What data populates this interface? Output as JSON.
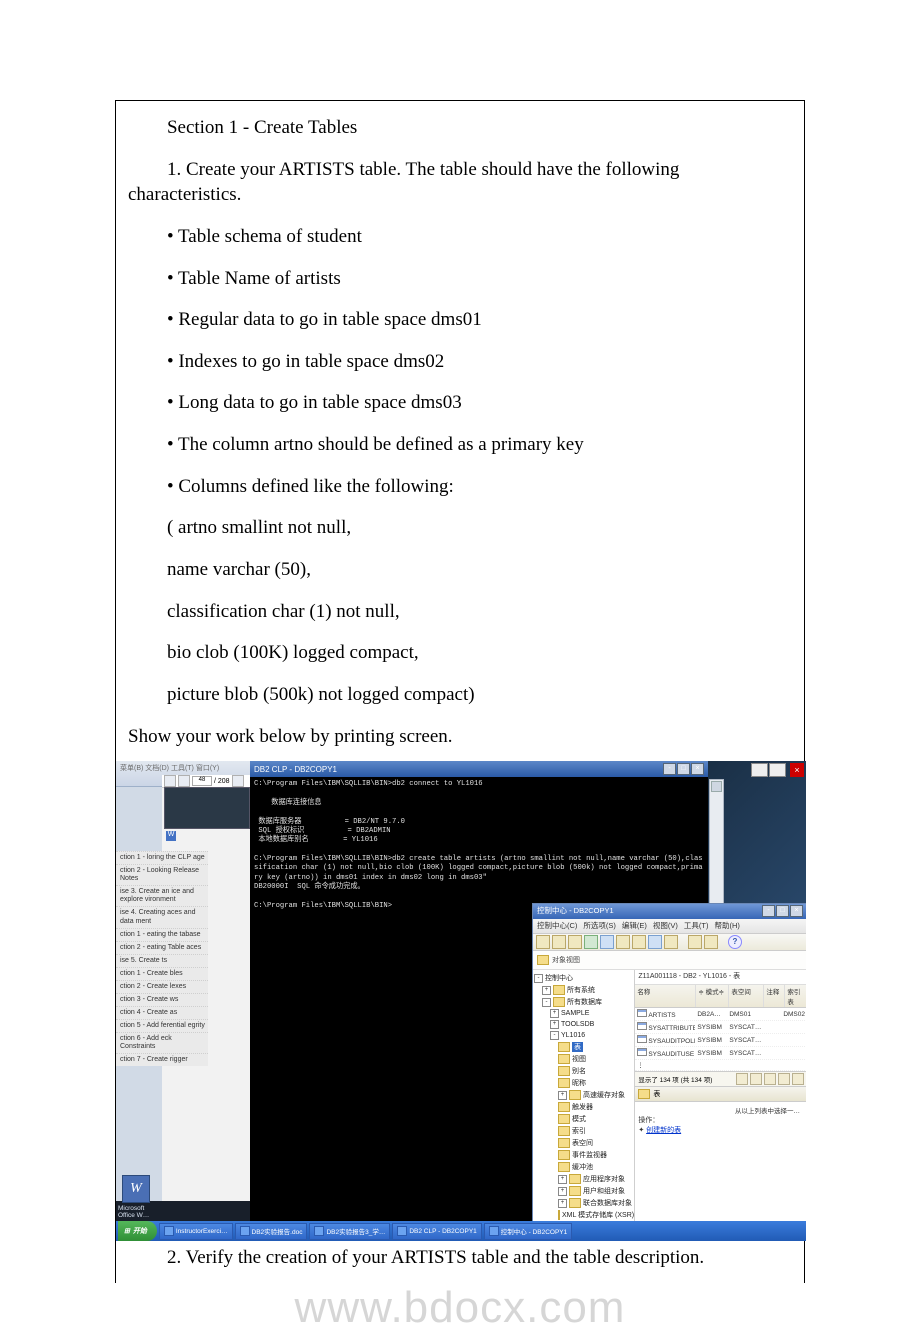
{
  "doc": {
    "section_title": "Section 1 - Create Tables",
    "intro": "1. Create your ARTISTS table. The table should have the following characteristics.",
    "bullets": [
      "• Table schema of student",
      "• Table Name of artists",
      "• Regular data to go in table space dms01",
      "• Indexes to go in table space dms02",
      "• Long data to go in table space dms03",
      "• The column artno should be defined as a primary key",
      "• Columns defined like the following:"
    ],
    "cols": [
      "( artno smallint not null,",
      " name varchar (50),",
      " classification char (1) not null,",
      " bio clob (100K) logged compact,",
      " picture blob (500k) not logged compact)"
    ],
    "show_work": "Show your work below by printing screen.",
    "verify": "2. Verify the creation of your ARTISTS table and the table description.",
    "watermark": "www.bdocx.com"
  },
  "left_menu_header": "菜单(B)  文档(D)  工具(T)  窗口(Y)",
  "nav": {
    "page": "48",
    "total": "/ 208"
  },
  "left_items": [
    "ction 1 - loring the CLP age",
    "ction 2 - Looking Release Notes",
    "ise 3. Create an ice and explore vironment",
    "ise 4. Creating aces and data ment",
    "ction 1 - eating the tabase",
    "ction 2 - eating Table aces",
    "ise 5. Create ts",
    "ction 1 - Create bles",
    "ction 2 - Create lexes",
    "ction 3 - Create ws",
    "ction 4 - Create as",
    "ction 5 - Add ferential egrity",
    "ction 6 - Add eck Constraints",
    "ction 7 - Create rigger"
  ],
  "word_app": {
    "label": "Microsoft Office W…"
  },
  "clp": {
    "title": "DB2 CLP - DB2COPY1",
    "line1": "C:\\Program Files\\IBM\\SQLLIB\\BIN>db2 connect to YL1016",
    "block_title": "    数据库连接信息",
    "kv1": " 数据库服务器          = DB2/NT 9.7.0",
    "kv2": " SQL 授权标识          = DB2ADMIN",
    "kv3": " 本地数据库别名        = YL1016",
    "create": "C:\\Program Files\\IBM\\SQLLIB\\BIN>db2 create table artists (artno smallint not null,name varchar (50),classification char (1) not null,bio clob (100K) logged compact,picture blob (500k) not logged compact,primary key (artno)) in dms01 index in dms02 long in dms03\"",
    "ok": "DB20000I  SQL 命令成功完成。",
    "prompt2": "C:\\Program Files\\IBM\\SQLLIB\\BIN>"
  },
  "ctrl": {
    "title": "控制中心 - DB2COPY1",
    "menu": [
      "控制中心(C)",
      "所选项(S)",
      "编辑(E)",
      "视图(V)",
      "工具(T)",
      "帮助(H)"
    ],
    "path_label": "对象视图",
    "tree": {
      "root": "控制中心",
      "all_sys": "所有系统",
      "all_db": "所有数据库",
      "sample": "SAMPLE",
      "toolsdb": "TOOLSDB",
      "yl": "YL1016",
      "tables": "表",
      "views": "视图",
      "alias": "别名",
      "nick": "昵称",
      "cache": "高速缓存对象",
      "trig": "触发器",
      "schema": "模式",
      "index": "索引",
      "ts": "表空间",
      "evm": "事件监视器",
      "bp": "缓冲池",
      "app": "应用程序对象",
      "ug": "用户和组对象",
      "fed": "联合数据库对象",
      "xml": "XML 模式存储库 (XSR)"
    },
    "right": {
      "breadcrumb": "Z11A001118 - DB2 - YL1016 - 表",
      "headers": [
        "名称",
        "模式",
        "表空间",
        "注释",
        "索引表"
      ],
      "rows": [
        [
          "ARTISTS",
          "DB2A…",
          "DMS01",
          "",
          "DMS02"
        ],
        [
          "SYSATTRIBUTES",
          "SYSIBM",
          "SYSCAT…",
          "",
          ""
        ],
        [
          "SYSAUDITPOLICIES",
          "SYSIBM",
          "SYSCAT…",
          "",
          ""
        ],
        [
          "SYSAUDITUSE",
          "SYSIBM",
          "SYSCAT…",
          "",
          ""
        ]
      ],
      "status": "显示了 134 项 (共 134 项)",
      "section": "表",
      "action_label": "操作：",
      "hint": "从以上列表中选择一…",
      "create_link": "创建新的表"
    }
  },
  "taskbar": {
    "start": "开始",
    "items": [
      "InstructorExerci…",
      "DB2实验报告.doc",
      "DB2实验报告3_学…",
      "DB2 CLP - DB2COPY1",
      "控制中心 - DB2COPY1"
    ]
  }
}
